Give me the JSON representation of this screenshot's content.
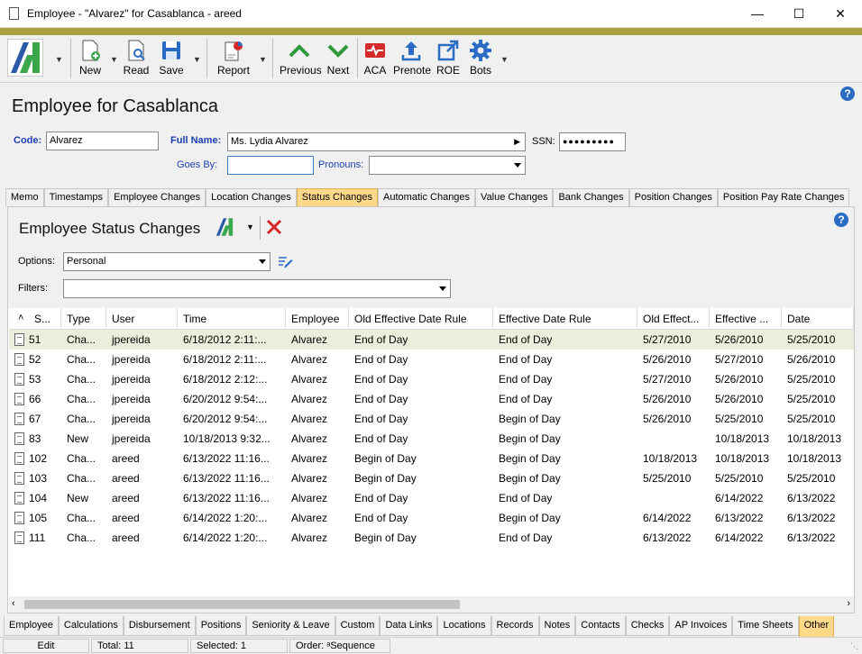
{
  "window": {
    "title": "Employee - \"Alvarez\" for Casablanca - areed"
  },
  "toolbar": {
    "new": "New",
    "read": "Read",
    "save": "Save",
    "report": "Report",
    "previous": "Previous",
    "next": "Next",
    "aca": "ACA",
    "prenote": "Prenote",
    "roe": "ROE",
    "bots": "Bots"
  },
  "page": {
    "title": "Employee for Casablanca"
  },
  "form": {
    "code_label": "Code:",
    "code_value": "Alvarez",
    "fullname_label": "Full Name:",
    "fullname_value": "Ms. Lydia Alvarez",
    "ssn_label": "SSN:",
    "ssn_value": "●●●●●●●●●",
    "goesby_label": "Goes By:",
    "goesby_value": "",
    "pronouns_label": "Pronouns:",
    "pronouns_value": ""
  },
  "tabs_top": [
    "Memo",
    "Timestamps",
    "Employee Changes",
    "Location Changes",
    "Status Changes",
    "Automatic Changes",
    "Value Changes",
    "Bank Changes",
    "Position Changes",
    "Position Pay Rate Changes"
  ],
  "tabs_top_active": 4,
  "panel": {
    "title": "Employee Status Changes",
    "options_label": "Options:",
    "options_value": "Personal",
    "filters_label": "Filters:",
    "filters_value": ""
  },
  "grid": {
    "columns": [
      "S...",
      "Type",
      "User",
      "Time",
      "Employee",
      "Old Effective Date Rule",
      "Effective Date Rule",
      "Old Effect...",
      "Effective ...",
      "Date"
    ],
    "rows": [
      [
        "51",
        "Cha...",
        "jpereida",
        "6/18/2012 2:11:...",
        "Alvarez",
        "End of Day",
        "End of Day",
        "5/27/2010",
        "5/26/2010",
        "5/25/2010"
      ],
      [
        "52",
        "Cha...",
        "jpereida",
        "6/18/2012 2:11:...",
        "Alvarez",
        "End of Day",
        "End of Day",
        "5/26/2010",
        "5/27/2010",
        "5/26/2010"
      ],
      [
        "53",
        "Cha...",
        "jpereida",
        "6/18/2012 2:12:...",
        "Alvarez",
        "End of Day",
        "End of Day",
        "5/27/2010",
        "5/26/2010",
        "5/25/2010"
      ],
      [
        "66",
        "Cha...",
        "jpereida",
        "6/20/2012 9:54:...",
        "Alvarez",
        "End of Day",
        "End of Day",
        "5/26/2010",
        "5/26/2010",
        "5/25/2010"
      ],
      [
        "67",
        "Cha...",
        "jpereida",
        "6/20/2012 9:54:...",
        "Alvarez",
        "End of Day",
        "Begin of Day",
        "5/26/2010",
        "5/25/2010",
        "5/25/2010"
      ],
      [
        "83",
        "New",
        "jpereida",
        "10/18/2013 9:32...",
        "Alvarez",
        "End of Day",
        "Begin of Day",
        "",
        "10/18/2013",
        "10/18/2013"
      ],
      [
        "102",
        "Cha...",
        "areed",
        "6/13/2022 11:16...",
        "Alvarez",
        "Begin of Day",
        "Begin of Day",
        "10/18/2013",
        "10/18/2013",
        "10/18/2013"
      ],
      [
        "103",
        "Cha...",
        "areed",
        "6/13/2022 11:16...",
        "Alvarez",
        "Begin of Day",
        "Begin of Day",
        "5/25/2010",
        "5/25/2010",
        "5/25/2010"
      ],
      [
        "104",
        "New",
        "areed",
        "6/13/2022 11:16...",
        "Alvarez",
        "End of Day",
        "End of Day",
        "",
        "6/14/2022",
        "6/13/2022"
      ],
      [
        "105",
        "Cha...",
        "areed",
        "6/14/2022 1:20:...",
        "Alvarez",
        "End of Day",
        "Begin of Day",
        "6/14/2022",
        "6/13/2022",
        "6/13/2022"
      ],
      [
        "111",
        "Cha...",
        "areed",
        "6/14/2022 1:20:...",
        "Alvarez",
        "Begin of Day",
        "End of Day",
        "6/13/2022",
        "6/14/2022",
        "6/13/2022"
      ]
    ],
    "selected_row": 0
  },
  "tabs_bottom": [
    "Employee",
    "Calculations",
    "Disbursement",
    "Positions",
    "Seniority & Leave",
    "Custom",
    "Data Links",
    "Locations",
    "Records",
    "Notes",
    "Contacts",
    "Checks",
    "AP Invoices",
    "Time Sheets",
    "Other"
  ],
  "tabs_bottom_active": 14,
  "status": {
    "mode": "Edit",
    "total": "Total: 11",
    "selected": "Selected: 1",
    "order": "Order: ᵃSequence"
  },
  "colors": {
    "accent_bar": "#a8a03c",
    "active_tab": "#ffd98a",
    "selected_row": "#eaeedc",
    "label_blue": "#1a3fb0",
    "delete_red": "#d42a2a"
  }
}
